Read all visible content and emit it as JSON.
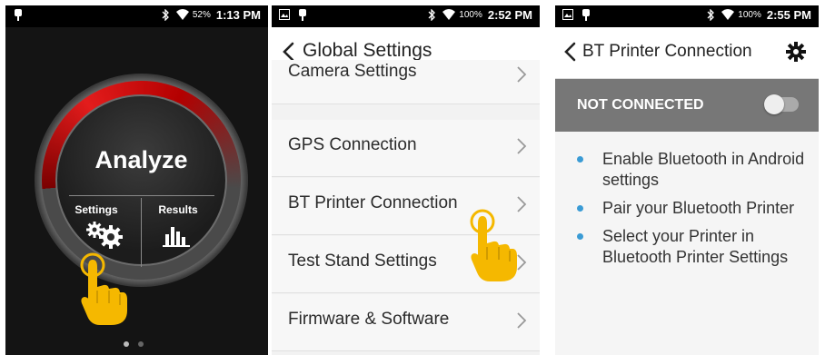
{
  "screens": [
    {
      "status": {
        "battery": "52%",
        "time": "1:13 PM"
      },
      "dial": {
        "title": "Analyze",
        "settings_label": "Settings",
        "results_label": "Results"
      }
    },
    {
      "status": {
        "battery": "100%",
        "time": "2:52 PM"
      },
      "title": "Global Settings",
      "items": [
        {
          "label": "Camera Settings"
        },
        {
          "label": "GPS Connection"
        },
        {
          "label": "BT Printer Connection"
        },
        {
          "label": "Test Stand Settings"
        },
        {
          "label": "Firmware & Software"
        }
      ]
    },
    {
      "status": {
        "battery": "100%",
        "time": "2:55 PM"
      },
      "title": "BT Printer Connection",
      "connection_status": "NOT CONNECTED",
      "toggle_on": false,
      "instructions": [
        "Enable Bluetooth in Android settings",
        "Pair your Bluetooth Printer",
        "Select your Printer in Bluetooth Printer Settings"
      ]
    }
  ],
  "colors": {
    "accent_red": "#e31c1c",
    "bullet_blue": "#3a9bd5",
    "hand": "#f5b800"
  }
}
